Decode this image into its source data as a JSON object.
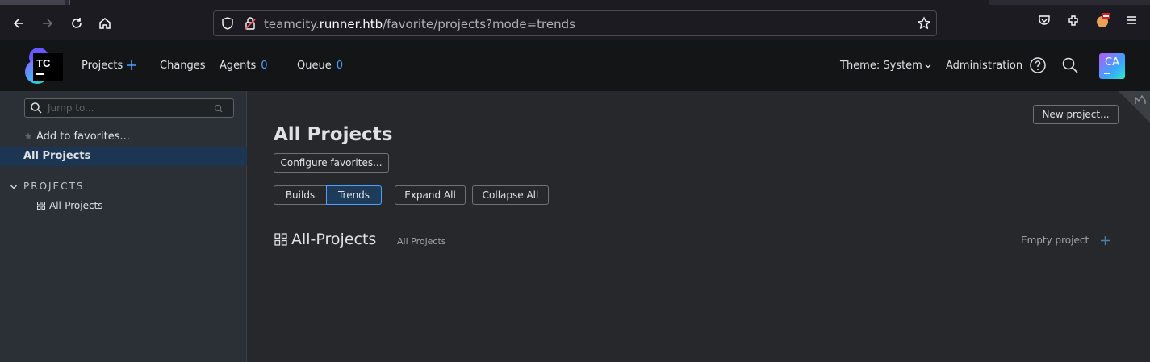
{
  "browser": {
    "url_prefix": "teamcity.",
    "url_host": "runner.htb",
    "url_path": "/favorite/projects?mode=trends"
  },
  "header": {
    "logo_text": "TC",
    "nav": {
      "projects": "Projects",
      "changes": "Changes",
      "agents": "Agents",
      "agents_count": "0",
      "queue": "Queue",
      "queue_count": "0"
    },
    "theme": "Theme: System",
    "administration": "Administration",
    "avatar_initials": "CA"
  },
  "sidebar": {
    "search_placeholder": "Jump to...",
    "add_favorites": "Add to favorites...",
    "all_projects": "All Projects",
    "section_title": "PROJECTS",
    "project_item": "All-Projects"
  },
  "main": {
    "title": "All Projects",
    "configure_favorites": "Configure favorites...",
    "builds_tab": "Builds",
    "trends_tab": "Trends",
    "expand_all": "Expand All",
    "collapse_all": "Collapse All",
    "new_project": "New project...",
    "project_name": "All-Projects",
    "project_sub": "All Projects",
    "empty_project": "Empty project"
  }
}
